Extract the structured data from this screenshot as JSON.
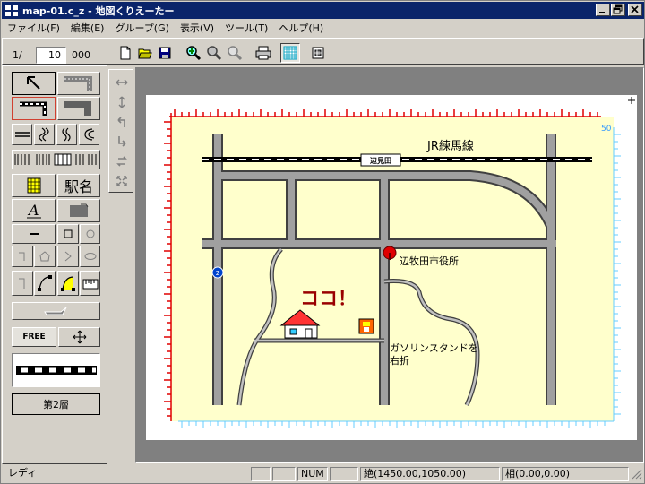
{
  "window": {
    "title": "map-01.c_z - 地図くりえーたー",
    "minimize": "_",
    "maximize": "▫",
    "close": "×"
  },
  "menu": {
    "items": [
      "ファイル(F)",
      "編集(E)",
      "グループ(G)",
      "表示(V)",
      "ツール(T)",
      "ヘルプ(H)"
    ]
  },
  "toolbar": {
    "layer_prefix": "1/",
    "layer_value": "10",
    "layer_suffix": "000"
  },
  "tools": {
    "station_name": "駅名",
    "free": "FREE",
    "layer_button": "第2層"
  },
  "map": {
    "rail_label": "JR練馬線",
    "station_sign": "辺見田",
    "city_hall": "辺牧田市役所",
    "here": "ココ！",
    "gas_line1": "ガソリンスタンドを",
    "gas_line2": "右折",
    "route_number": "2",
    "ruler_number": "50"
  },
  "status": {
    "ready": "レディ",
    "num": "NUM",
    "absolute": "絶(1450.00,1050.00)",
    "relative": "相(0.00,0.00)"
  },
  "colors": {
    "title_bg": "#0a246a",
    "map_bg": "#ffffcc",
    "road": "#a0a0a0",
    "ruler_red": "#e00000",
    "ruler_cyan": "#66ccff",
    "accent_red": "#990000"
  }
}
